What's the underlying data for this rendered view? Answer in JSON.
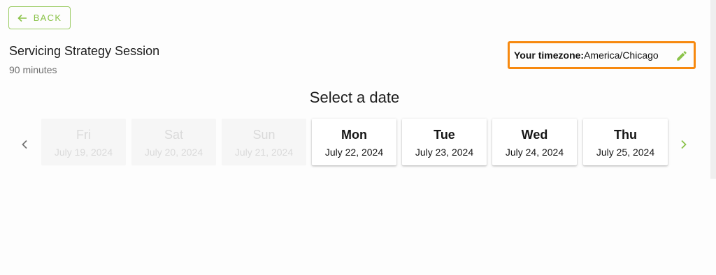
{
  "back_button": {
    "label": "BACK",
    "icon": "arrow-left-icon"
  },
  "event": {
    "title": "Servicing Strategy Session",
    "duration": "90 minutes"
  },
  "timezone": {
    "label": "Your timezone:",
    "value": "America/Chicago",
    "edit_icon": "pencil-icon"
  },
  "date_picker": {
    "heading": "Select a date",
    "prev_icon": "chevron-left-icon",
    "next_icon": "chevron-right-icon",
    "days": [
      {
        "day": "Fri",
        "date": "July 19, 2024",
        "available": false
      },
      {
        "day": "Sat",
        "date": "July 20, 2024",
        "available": false
      },
      {
        "day": "Sun",
        "date": "July 21, 2024",
        "available": false
      },
      {
        "day": "Mon",
        "date": "July 22, 2024",
        "available": true
      },
      {
        "day": "Tue",
        "date": "July 23, 2024",
        "available": true
      },
      {
        "day": "Wed",
        "date": "July 24, 2024",
        "available": true
      },
      {
        "day": "Thu",
        "date": "July 25, 2024",
        "available": true
      }
    ]
  },
  "colors": {
    "accent_green": "#8bc34a",
    "highlight_orange": "#f7890f"
  }
}
